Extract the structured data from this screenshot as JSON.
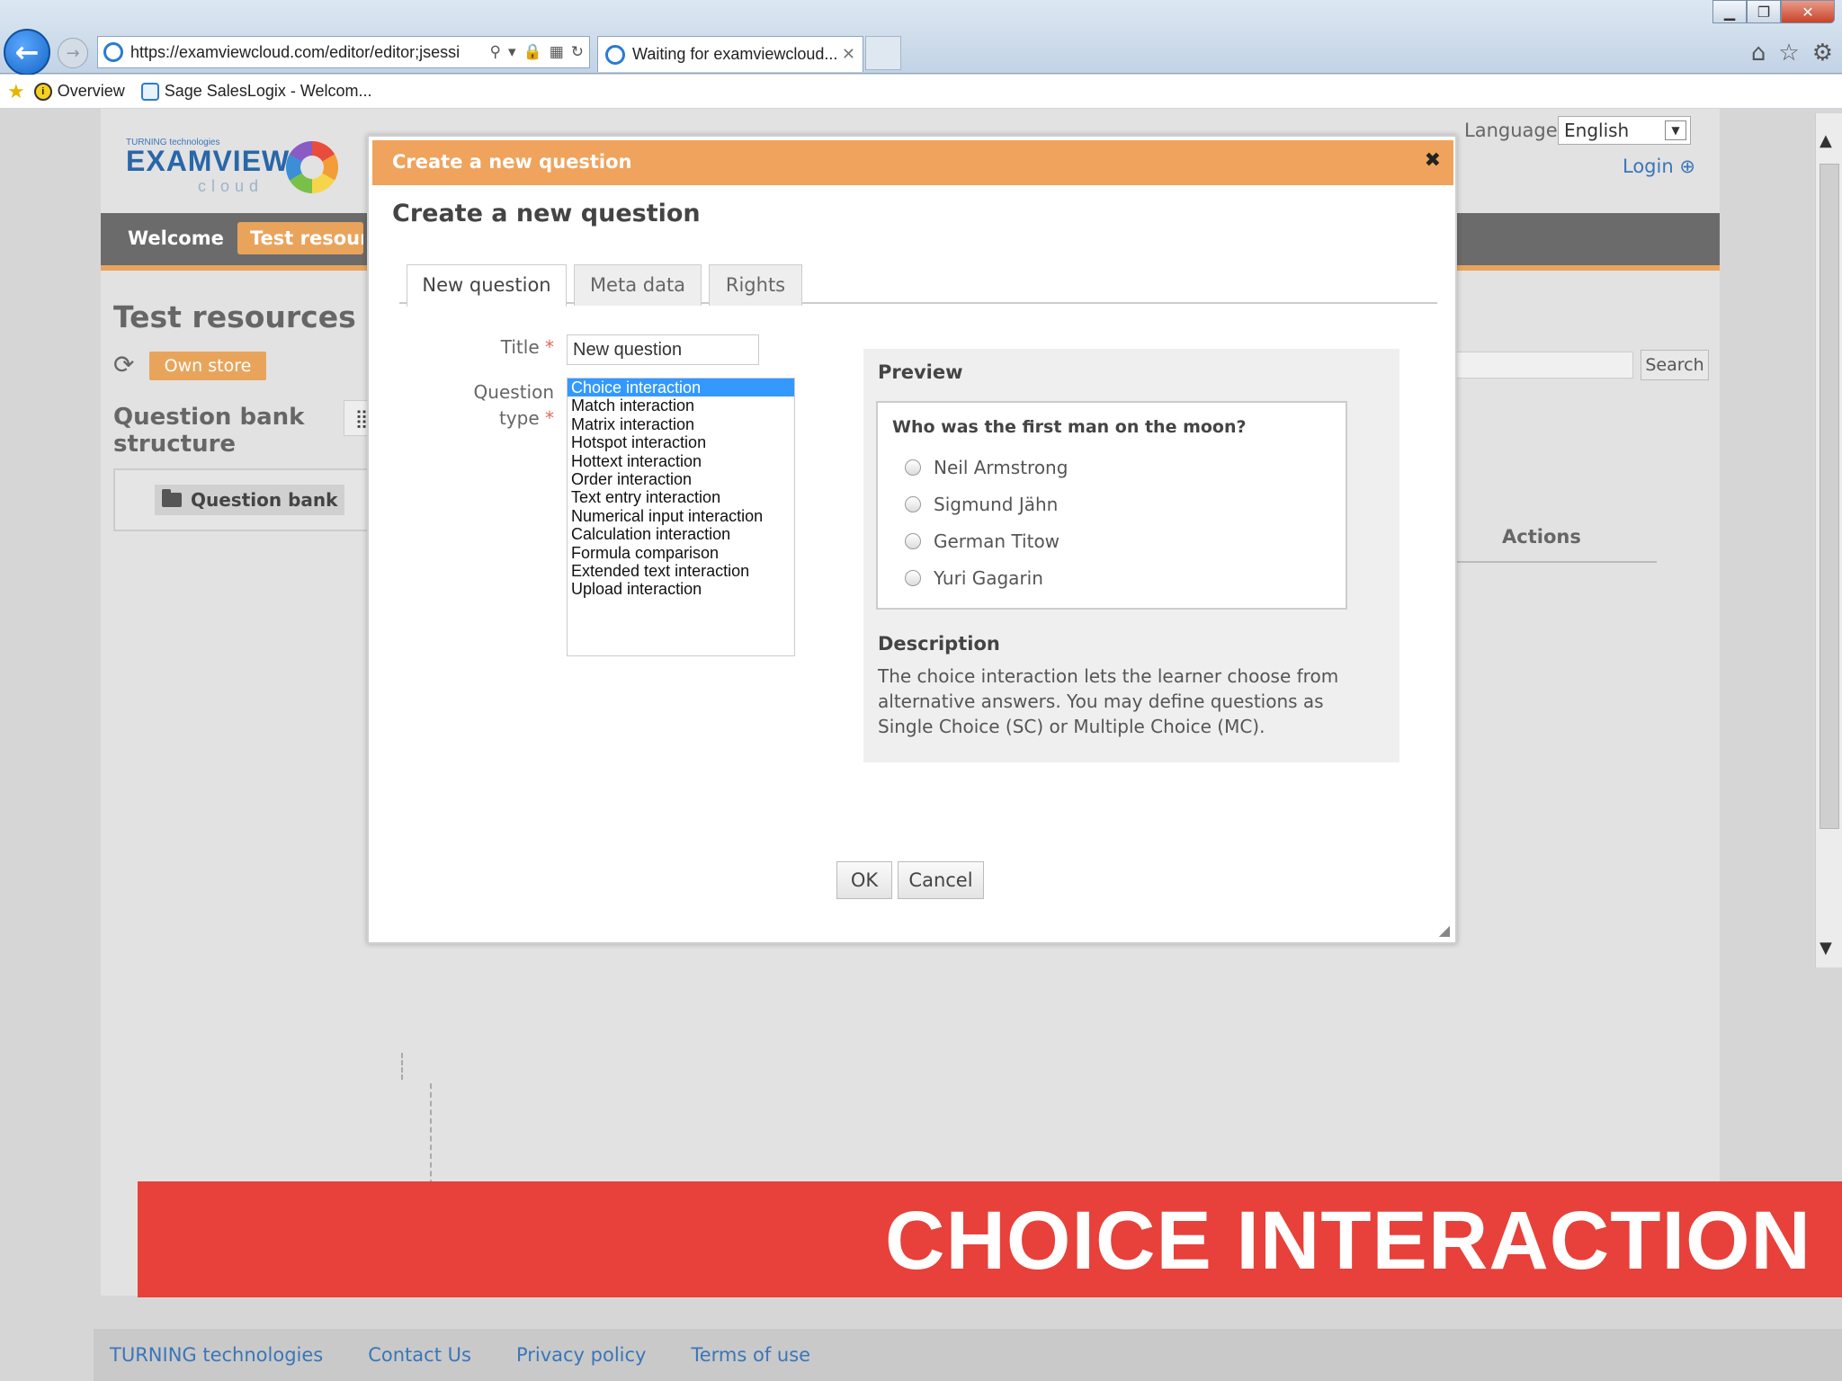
{
  "browser": {
    "url": "https://examviewcloud.com/editor/editor;jsessi",
    "tab_label": "Waiting for examviewcloud...",
    "favorites": [
      "Overview",
      "Sage SalesLogix - Welcom..."
    ]
  },
  "app": {
    "logo_small": "TURNING technologies",
    "logo_big": "EXAMVIEW",
    "logo_cloud": "cloud",
    "menu": {
      "welcome": "Welcome",
      "test_resources": "Test resources"
    },
    "language_label": "Language",
    "language_value": "English",
    "login": "Login",
    "page_title": "Test resources",
    "own_store": "Own store",
    "qb_structure_title": "Question bank structure",
    "tree_item": "Question bank",
    "search_button": "Search",
    "actions_header": "Actions"
  },
  "dialog": {
    "titlebar": "Create a new question",
    "heading": "Create a new question",
    "tabs": [
      "New question",
      "Meta data",
      "Rights"
    ],
    "title_label": "Title",
    "required_mark": "*",
    "title_value": "New question",
    "qtype_label_line1": "Question",
    "qtype_label_line2": "type",
    "question_types": [
      "Choice interaction",
      "Match interaction",
      "Matrix interaction",
      "Hotspot interaction",
      "Hottext interaction",
      "Order interaction",
      "Text entry interaction",
      "Numerical input interaction",
      "Calculation interaction",
      "Formula comparison",
      "Extended text interaction",
      "Upload interaction"
    ],
    "selected_type_index": 0,
    "preview_label": "Preview",
    "preview_question": "Who was the first man on the moon?",
    "preview_options": [
      "Neil Armstrong",
      "Sigmund Jähn",
      "German Titow",
      "Yuri Gagarin"
    ],
    "description_label": "Description",
    "description_text": "The choice interaction lets the learner choose from alternative answers. You may define questions as Single Choice (SC) or Multiple Choice (MC).",
    "ok_button": "OK",
    "cancel_button": "Cancel"
  },
  "banner": {
    "text": "CHOICE INTERACTION",
    "color": "#e8403a"
  },
  "footer": {
    "links": [
      "TURNING technologies",
      "Contact Us",
      "Privacy policy",
      "Terms of use"
    ]
  },
  "colors": {
    "accent_orange": "#f0a35c",
    "link_blue": "#3a76b9",
    "selection_blue": "#3399ff"
  }
}
